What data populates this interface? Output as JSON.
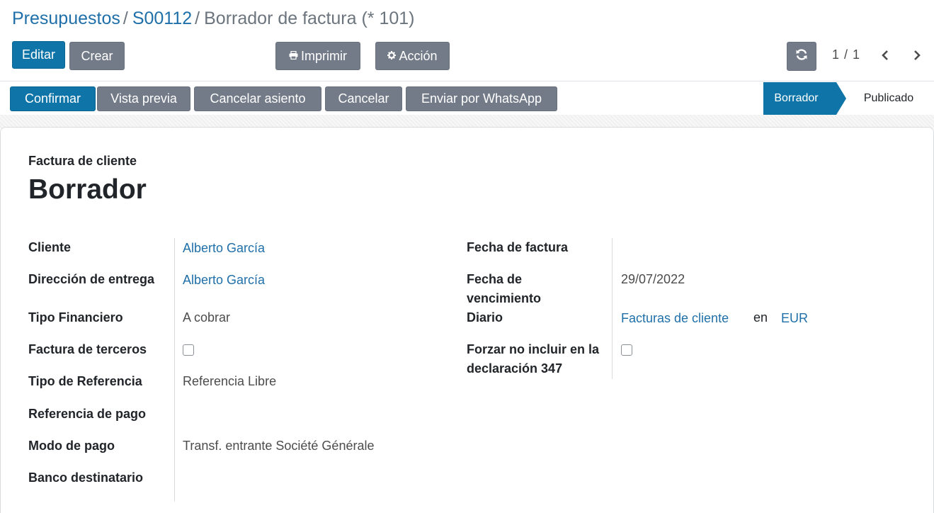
{
  "breadcrumb": {
    "item1": "Presupuestos",
    "sep": "/",
    "item2": "S00112",
    "current": "Borrador de factura (* 101)"
  },
  "toolbar": {
    "edit_label": "Editar",
    "create_label": "Crear",
    "print_label": "Imprimir",
    "action_label": "Acción",
    "pager": "1 / 1"
  },
  "statusbar": {
    "buttons": [
      "Confirmar",
      "Vista previa",
      "Cancelar asiento",
      "Cancelar",
      "Enviar por WhatsApp"
    ],
    "stages": [
      "Borrador",
      "Publicado"
    ],
    "active_stage": "Borrador"
  },
  "form": {
    "subtitle": "Factura de cliente",
    "title": "Borrador",
    "left": {
      "cliente_label": "Cliente",
      "cliente_value": "Alberto García",
      "direccion_label": "Dirección de entrega",
      "direccion_value": "Alberto García",
      "tipo_financiero_label": "Tipo Financiero",
      "tipo_financiero_value": "A cobrar",
      "factura_terceros_label": "Factura de terceros",
      "factura_terceros_checked": false,
      "tipo_referencia_label": "Tipo de Referencia",
      "tipo_referencia_value": "Referencia Libre",
      "referencia_pago_label": "Referencia de pago",
      "referencia_pago_value": "",
      "modo_pago_label": "Modo de pago",
      "modo_pago_value": "Transf. entrante Société Générale",
      "banco_label": "Banco destinatario",
      "banco_value": ""
    },
    "right": {
      "fecha_factura_label": "Fecha de factura",
      "fecha_factura_value": "",
      "fecha_venc_label": "Fecha de vencimiento",
      "fecha_venc_value": "29/07/2022",
      "diario_label": "Diario",
      "diario_value": "Facturas de cliente",
      "diario_en": "en",
      "diario_currency": "EUR",
      "forzar_label": "Forzar no incluir en la declaración 347",
      "forzar_checked": false
    }
  },
  "colors": {
    "primary": "#0f75a8",
    "secondary": "#737a88",
    "link": "#1f6fa8"
  }
}
